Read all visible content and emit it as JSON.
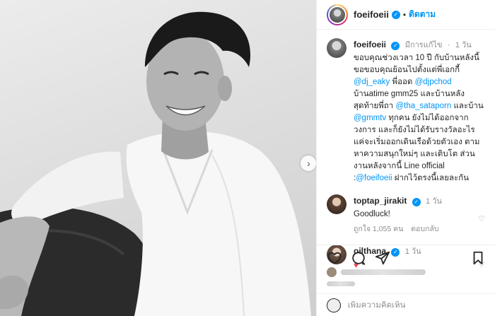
{
  "post": {
    "username": "foeifoeii",
    "follow_label": "ติดตาม",
    "dot": "•"
  },
  "caption": {
    "username": "foeifoeii",
    "edited": "มีการแก้ไข",
    "dot": "·",
    "time": "1 วัน",
    "parts": {
      "p1": "ขอบคุณช่วงเวลา 10 ปี กับบ้านหลังนี้ ขอขอบคุณย้อนไปตั้งแต่พี่เอกกี้ ",
      "m1": "@dj_eaky",
      "p2": " พี่ออด ",
      "m2": "@djpchod",
      "p3": " บ้านatime gmm25 และบ้านหลังสุดท้ายพี่ถา ",
      "m3": "@tha_sataporn",
      "p4": " และบ้าน ",
      "m4": "@gmmtv",
      "p5": " ทุกคน ยังไม่ได้ออกจากวงการ และก็ยังไม่ได้รับรางวัลอะไร แค่จะเริ่มออกเดินเรือด้วยตัวเอง ตามหาความสนุกใหม่ๆ และเติบโต ส่วนงานหลังจากนี้ Line official :",
      "m5": "@foeifoeii",
      "p6": " ฝากไว้ตรงนี้เลยละกัน"
    }
  },
  "comments": [
    {
      "username": "toptap_jirakit",
      "time": "1 วัน",
      "text": "Goodluck!",
      "likes": "ถูกใจ 1,055 คน",
      "reply": "ตอบกลับ"
    },
    {
      "username": "oilthana",
      "time": "1 วัน",
      "text": "♥"
    }
  ],
  "add_comment": {
    "placeholder": "เพิ่มความคิดเห็น"
  },
  "colors": {
    "accent": "#0095f6",
    "mention": "#00376b",
    "heart": "#ed4956"
  }
}
